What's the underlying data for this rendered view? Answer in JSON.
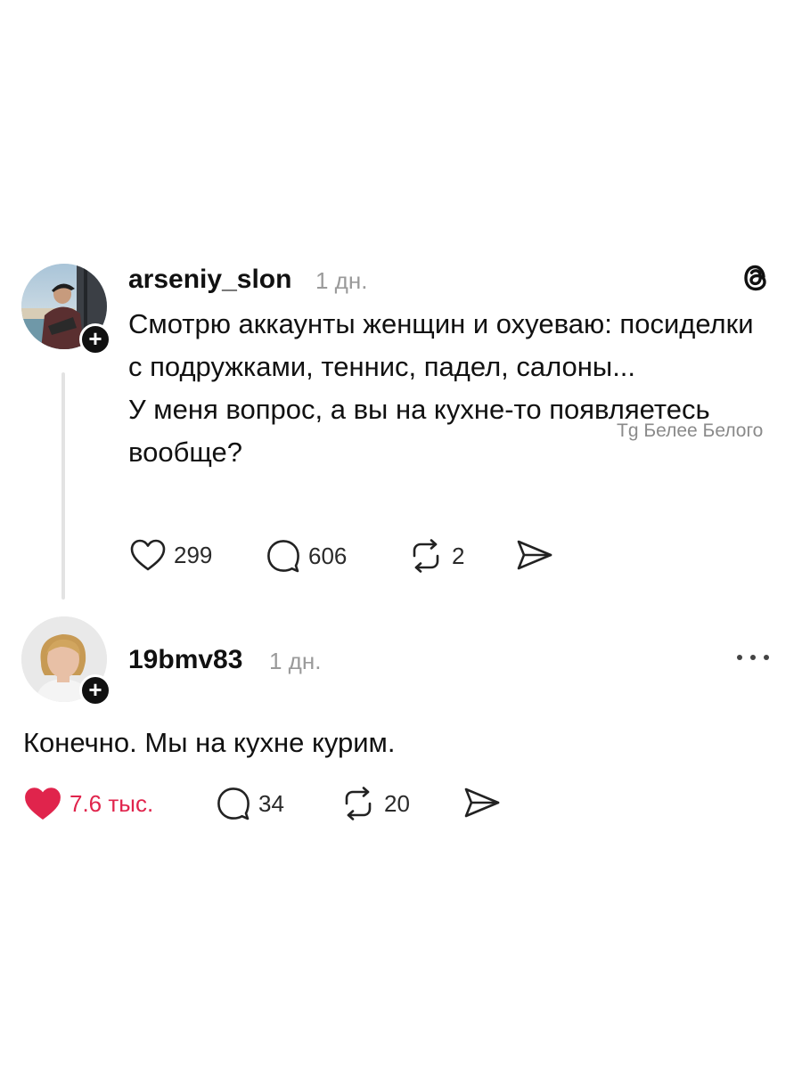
{
  "post": {
    "username": "arseniy_slon",
    "time": "1 дн.",
    "paragraphs": [
      "Смотрю аккаунты женщин и охуеваю: посиделки с подружками, теннис, падел, салоны...",
      "У меня вопрос, а вы на кухне-то появляетесь вообще?"
    ],
    "likes": "299",
    "comments": "606",
    "reposts": "2",
    "brand_icon": "threads-logo-icon"
  },
  "watermark": "Tg Белее Белого",
  "reply": {
    "username": "19bmv83",
    "time": "1 дн.",
    "text": "Конечно. Мы на кухне курим.",
    "likes": "7.6 тыс.",
    "comments": "34",
    "reposts": "20",
    "liked": true,
    "like_color": "#e0244c"
  }
}
